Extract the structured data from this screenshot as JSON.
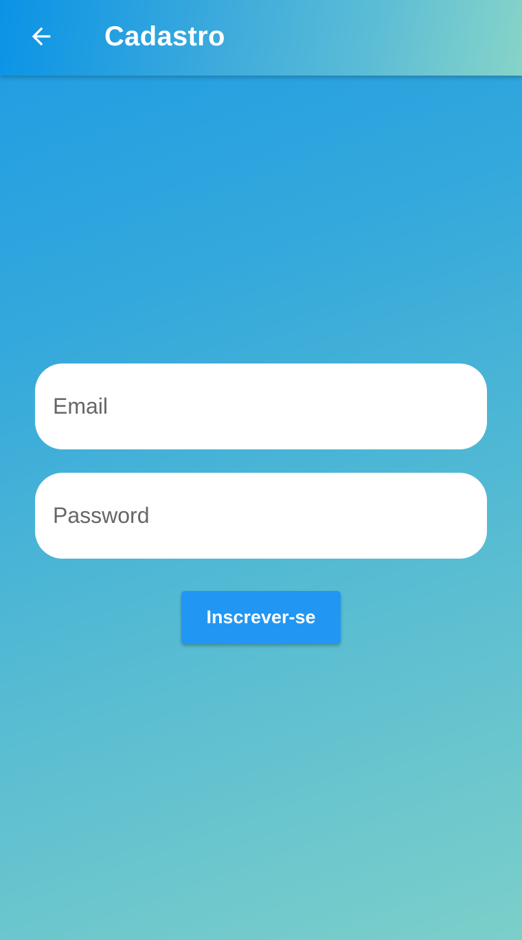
{
  "app_bar": {
    "title": "Cadastro",
    "back_icon": "arrow-left-icon"
  },
  "form": {
    "email_placeholder": "Email",
    "email_value": "",
    "password_placeholder": "Password",
    "password_value": "",
    "submit_label": "Inscrever-se"
  },
  "colors": {
    "button": "#2196f3",
    "gradient_start": "#0a93e6",
    "gradient_end": "#86d4c8"
  }
}
